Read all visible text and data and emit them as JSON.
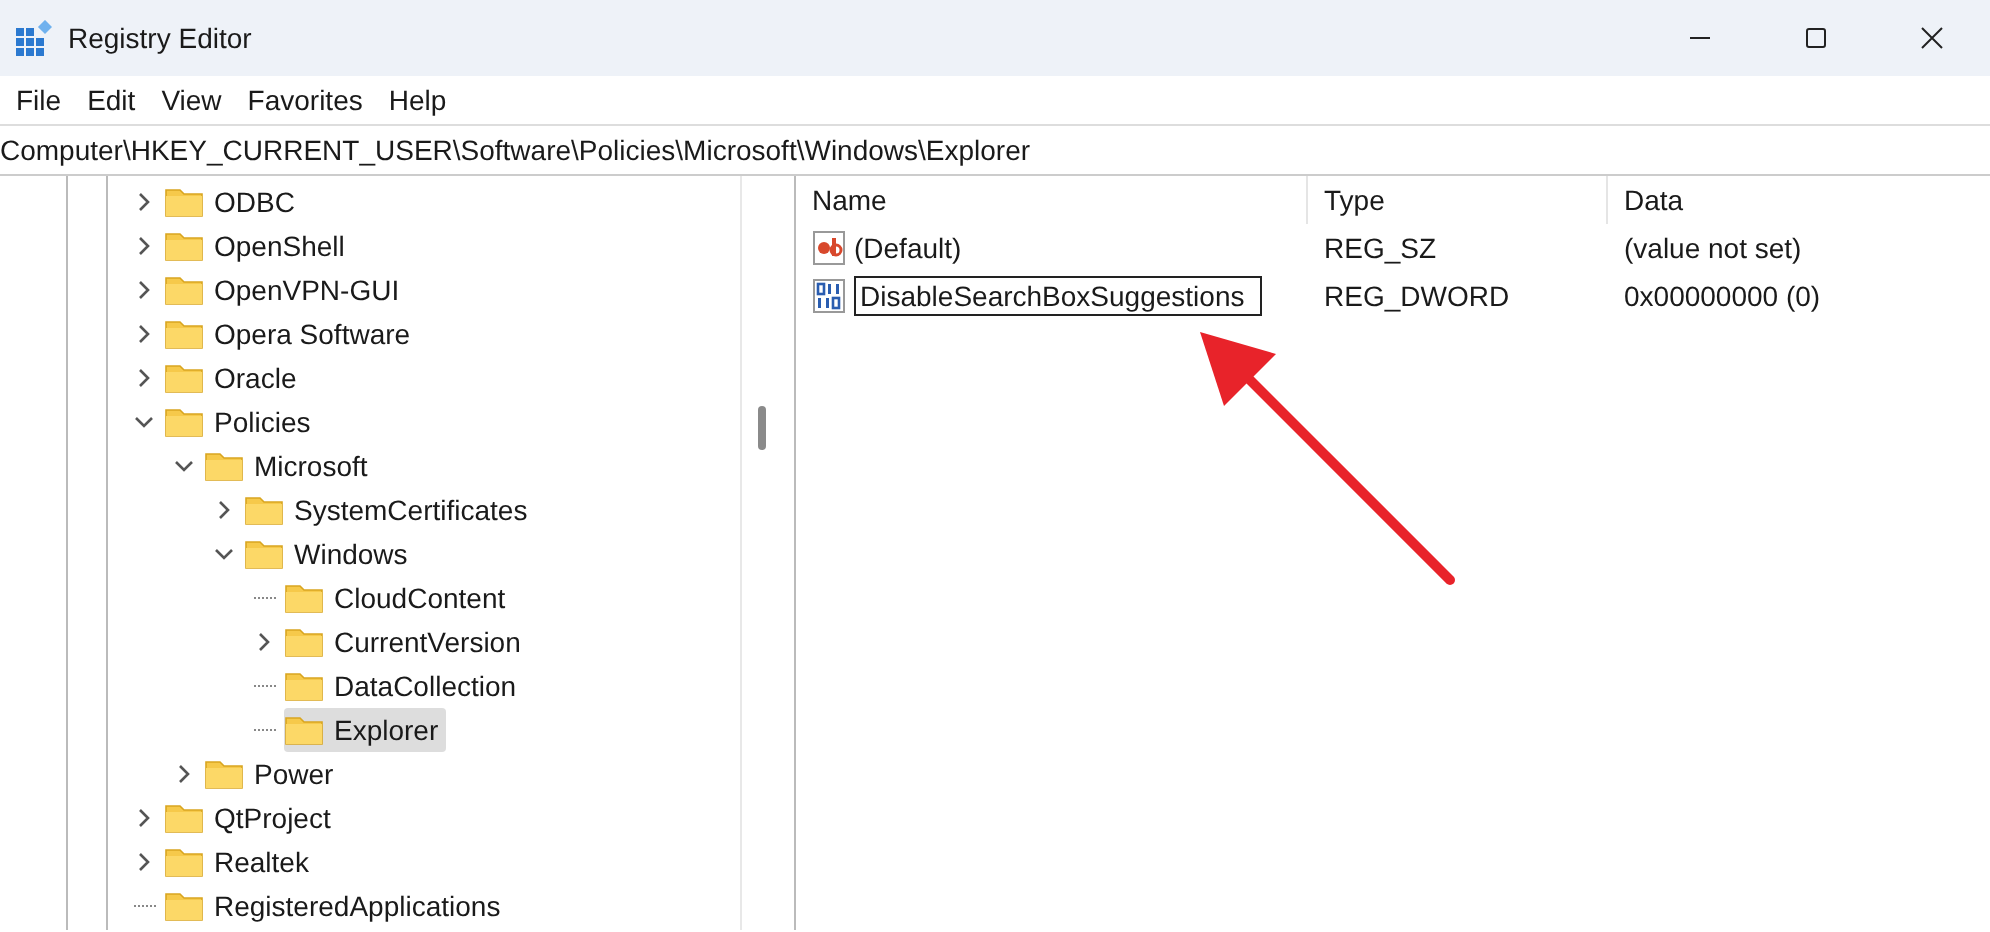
{
  "window": {
    "title": "Registry Editor"
  },
  "menu": [
    "File",
    "Edit",
    "View",
    "Favorites",
    "Help"
  ],
  "address": "Computer\\HKEY_CURRENT_USER\\Software\\Policies\\Microsoft\\Windows\\Explorer",
  "tree": [
    {
      "label": "ODBC",
      "expandable": true,
      "expanded": false,
      "selected": false
    },
    {
      "label": "OpenShell",
      "expandable": true,
      "expanded": false,
      "selected": false
    },
    {
      "label": "OpenVPN-GUI",
      "expandable": true,
      "expanded": false,
      "selected": false
    },
    {
      "label": "Opera Software",
      "expandable": true,
      "expanded": false,
      "selected": false
    },
    {
      "label": "Oracle",
      "expandable": true,
      "expanded": false,
      "selected": false
    },
    {
      "label": "Policies",
      "expandable": true,
      "expanded": true,
      "selected": false,
      "children": [
        {
          "label": "Microsoft",
          "expandable": true,
          "expanded": true,
          "selected": false,
          "children": [
            {
              "label": "SystemCertificates",
              "expandable": true,
              "expanded": false,
              "selected": false
            },
            {
              "label": "Windows",
              "expandable": true,
              "expanded": true,
              "selected": false,
              "children": [
                {
                  "label": "CloudContent",
                  "expandable": false,
                  "selected": false
                },
                {
                  "label": "CurrentVersion",
                  "expandable": true,
                  "expanded": false,
                  "selected": false
                },
                {
                  "label": "DataCollection",
                  "expandable": false,
                  "selected": false
                },
                {
                  "label": "Explorer",
                  "expandable": false,
                  "selected": true
                }
              ]
            }
          ]
        },
        {
          "label": "Power",
          "expandable": true,
          "expanded": false,
          "selected": false
        }
      ]
    },
    {
      "label": "QtProject",
      "expandable": true,
      "expanded": false,
      "selected": false
    },
    {
      "label": "Realtek",
      "expandable": true,
      "expanded": false,
      "selected": false
    },
    {
      "label": "RegisteredApplications",
      "expandable": false,
      "selected": false
    }
  ],
  "values": {
    "columns": [
      "Name",
      "Type",
      "Data"
    ],
    "rows": [
      {
        "kind": "string",
        "name": "(Default)",
        "type": "REG_SZ",
        "data": "(value not set)",
        "editing": false
      },
      {
        "kind": "binary",
        "name": "DisableSearchBoxSuggestions",
        "type": "REG_DWORD",
        "data": "0x00000000 (0)",
        "editing": true
      }
    ]
  }
}
